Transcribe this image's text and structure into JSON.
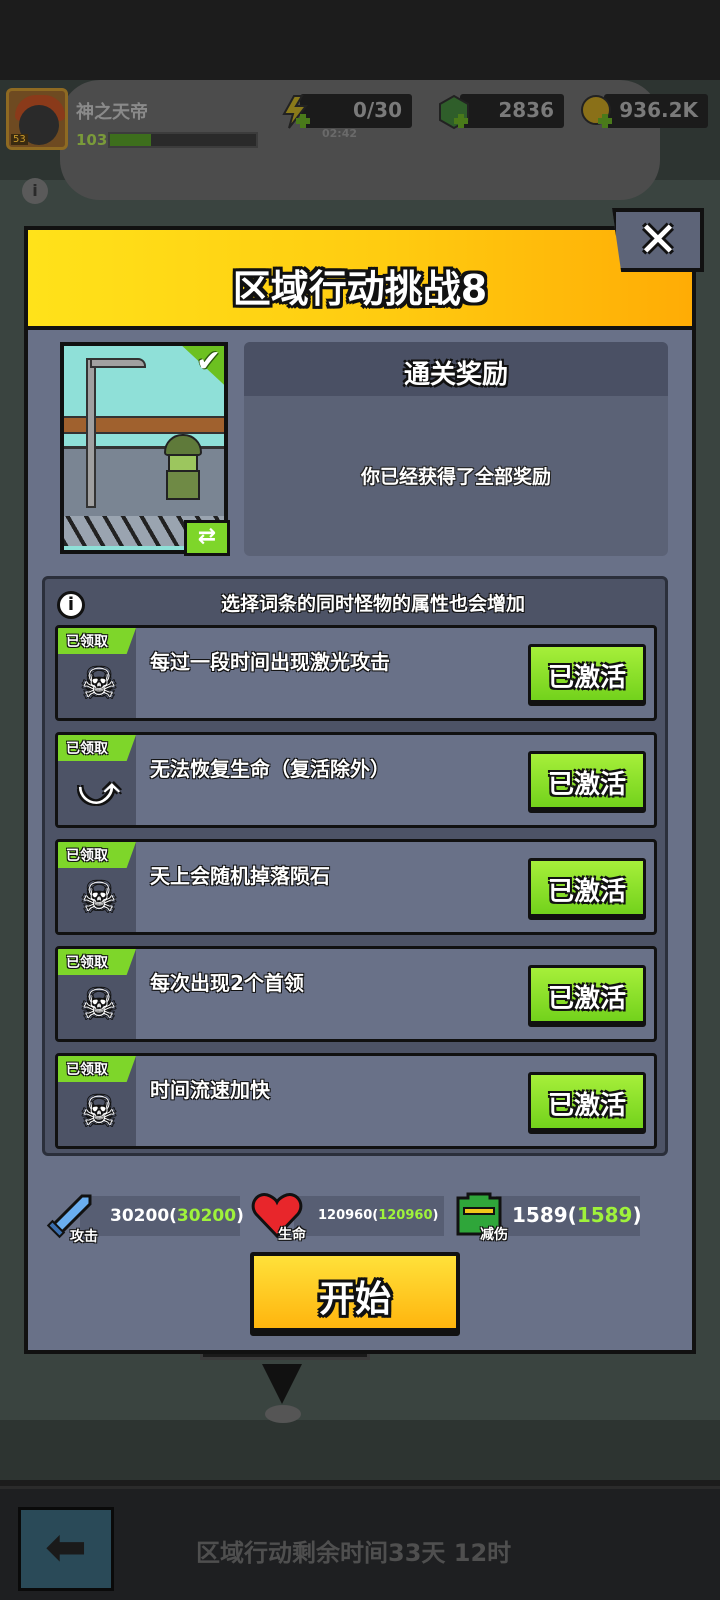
{
  "player": {
    "name": "神之天帝",
    "level": "103",
    "avatar_level": "53",
    "xp_fraction": 0.28
  },
  "resources": {
    "energy": "0/30",
    "energy_timer": "02:42",
    "gems": "2836",
    "coins": "936.2K"
  },
  "modal": {
    "title": "区域行动挑战8",
    "close_label": "✕",
    "rewards_title": "通关奖励",
    "rewards_message": "你已经获得了全部奖励",
    "conditions_header": "选择词条的同时怪物的属性也会增加",
    "conditions": [
      {
        "tag": "已领取",
        "text": "每过一段时间出现激光攻击",
        "button": "已激活",
        "icon": "skull-icon"
      },
      {
        "tag": "已领取",
        "text": "无法恢复生命（复活除外）",
        "button": "已激活",
        "icon": "no-heal-icon"
      },
      {
        "tag": "已领取",
        "text": "天上会随机掉落陨石",
        "button": "已激活",
        "icon": "skull-icon"
      },
      {
        "tag": "已领取",
        "text": "每次出现2个首领",
        "button": "已激活",
        "icon": "skull-icon"
      },
      {
        "tag": "已领取",
        "text": "时间流速加快",
        "button": "已激活",
        "icon": "skull-icon"
      }
    ],
    "stats": {
      "attack": {
        "label": "攻击",
        "value": "30200(",
        "bonus": "30200",
        "close": ")"
      },
      "health": {
        "label": "生命",
        "value": "120960(",
        "bonus": "120960",
        "close": ")"
      },
      "defense": {
        "label": "减伤",
        "value": "1589(",
        "bonus": "1589",
        "close": ")"
      }
    },
    "start_label": "开始"
  },
  "bottom": {
    "remaining_text": "区域行动剩余时间33天 12时"
  },
  "colors": {
    "header_yellow": "#ffd616",
    "button_green": "#7ed62a",
    "start_orange": "#ffb50e",
    "panel": "#697188"
  }
}
